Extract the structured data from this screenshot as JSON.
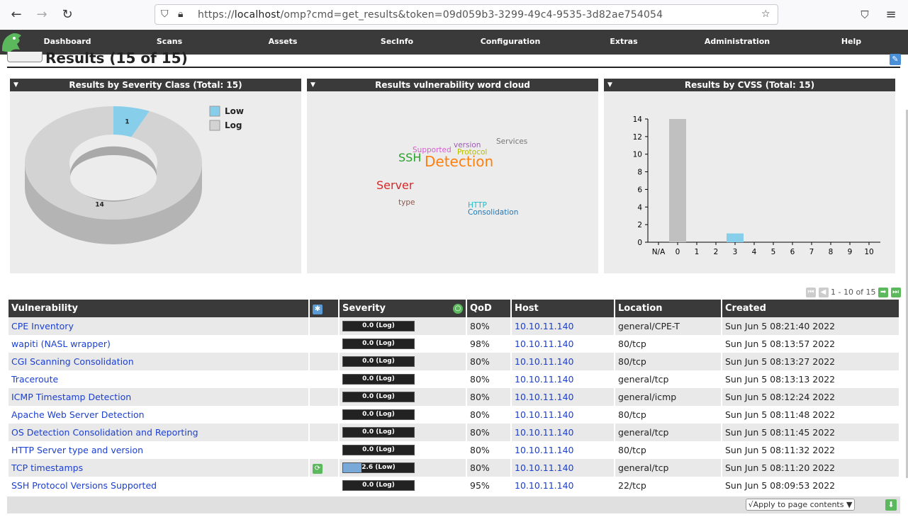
{
  "browser": {
    "url_prefix": "https://",
    "url_host": "localhost",
    "url_path": "/omp?cmd=get_results&token=09d059b3-3299-49c4-9535-3d82ae754054"
  },
  "menu": [
    "Dashboard",
    "Scans",
    "Assets",
    "SecInfo",
    "Configuration",
    "Extras",
    "Administration",
    "Help"
  ],
  "page": {
    "title": "Results (15 of 15)"
  },
  "panels": {
    "severity": {
      "title": "Results by Severity Class (Total: 15)"
    },
    "wordcloud": {
      "title": "Results vulnerability word cloud"
    },
    "cvss": {
      "title": "Results by CVSS (Total: 15)"
    }
  },
  "chart_data": [
    {
      "type": "pie",
      "title": "Results by Severity Class (Total: 15)",
      "categories": [
        "Low",
        "Log"
      ],
      "values": [
        1,
        14
      ],
      "colors": [
        "#87ceeb",
        "#d3d3d3"
      ],
      "legend": "top-right"
    },
    {
      "type": "bar",
      "title": "Results by CVSS (Total: 15)",
      "categories": [
        "N/A",
        "0",
        "1",
        "2",
        "3",
        "4",
        "5",
        "6",
        "7",
        "8",
        "9",
        "10"
      ],
      "values": [
        0,
        14,
        0,
        0,
        1,
        0,
        0,
        0,
        0,
        0,
        0,
        0
      ],
      "colors": [
        "#c0c0c0",
        "#c0c0c0",
        "#87ceeb",
        "#87ceeb",
        "#87ceeb",
        "#ffa500",
        "#ffa500",
        "#ffa500",
        "#ff0000",
        "#ff0000",
        "#ff0000",
        "#ff0000"
      ],
      "ylim": [
        0,
        14
      ],
      "yticks": [
        0,
        2,
        4,
        6,
        8,
        10,
        12,
        14
      ]
    }
  ],
  "wordcloud": [
    {
      "text": "Services",
      "color": "#777777"
    },
    {
      "text": "version",
      "color": "#9b59b6"
    },
    {
      "text": "Supported",
      "color": "#d45ecf"
    },
    {
      "text": "Protocol",
      "color": "#b5bd00"
    },
    {
      "text": "SSH",
      "color": "#2ca02c"
    },
    {
      "text": "Detection",
      "color": "#ff7f0e"
    },
    {
      "text": "Server",
      "color": "#d62728"
    },
    {
      "text": "type",
      "color": "#8c564b"
    },
    {
      "text": "HTTP",
      "color": "#17becf"
    },
    {
      "text": "Consolidation",
      "color": "#1f77b4"
    }
  ],
  "pager": {
    "text": "1 - 10 of 15"
  },
  "table": {
    "headers": [
      "Vulnerability",
      "",
      "Severity",
      "QoD",
      "Host",
      "Location",
      "Created"
    ],
    "rows": [
      {
        "vuln": "CPE Inventory",
        "sev": "0.0 (Log)",
        "sev_value": 0.0,
        "qod": "80%",
        "host": "10.10.11.140",
        "loc": "general/CPE-T",
        "created": "Sun Jun 5 08:21:40 2022",
        "icon": false
      },
      {
        "vuln": "wapiti (NASL wrapper)",
        "sev": "0.0 (Log)",
        "sev_value": 0.0,
        "qod": "98%",
        "host": "10.10.11.140",
        "loc": "80/tcp",
        "created": "Sun Jun 5 08:13:57 2022",
        "icon": false
      },
      {
        "vuln": "CGI Scanning Consolidation",
        "sev": "0.0 (Log)",
        "sev_value": 0.0,
        "qod": "80%",
        "host": "10.10.11.140",
        "loc": "80/tcp",
        "created": "Sun Jun 5 08:13:27 2022",
        "icon": false
      },
      {
        "vuln": "Traceroute",
        "sev": "0.0 (Log)",
        "sev_value": 0.0,
        "qod": "80%",
        "host": "10.10.11.140",
        "loc": "general/tcp",
        "created": "Sun Jun 5 08:13:13 2022",
        "icon": false
      },
      {
        "vuln": "ICMP Timestamp Detection",
        "sev": "0.0 (Log)",
        "sev_value": 0.0,
        "qod": "80%",
        "host": "10.10.11.140",
        "loc": "general/icmp",
        "created": "Sun Jun 5 08:12:24 2022",
        "icon": false
      },
      {
        "vuln": "Apache Web Server Detection",
        "sev": "0.0 (Log)",
        "sev_value": 0.0,
        "qod": "80%",
        "host": "10.10.11.140",
        "loc": "80/tcp",
        "created": "Sun Jun 5 08:11:48 2022",
        "icon": false
      },
      {
        "vuln": "OS Detection Consolidation and Reporting",
        "sev": "0.0 (Log)",
        "sev_value": 0.0,
        "qod": "80%",
        "host": "10.10.11.140",
        "loc": "general/tcp",
        "created": "Sun Jun 5 08:11:45 2022",
        "icon": false
      },
      {
        "vuln": "HTTP Server type and version",
        "sev": "0.0 (Log)",
        "sev_value": 0.0,
        "qod": "80%",
        "host": "10.10.11.140",
        "loc": "80/tcp",
        "created": "Sun Jun 5 08:11:32 2022",
        "icon": false
      },
      {
        "vuln": "TCP timestamps",
        "sev": "2.6 (Low)",
        "sev_value": 2.6,
        "qod": "80%",
        "host": "10.10.11.140",
        "loc": "general/tcp",
        "created": "Sun Jun 5 08:11:20 2022",
        "icon": true
      },
      {
        "vuln": "SSH Protocol Versions Supported",
        "sev": "0.0 (Log)",
        "sev_value": 0.0,
        "qod": "95%",
        "host": "10.10.11.140",
        "loc": "22/tcp",
        "created": "Sun Jun 5 08:09:53 2022",
        "icon": false
      }
    ]
  },
  "footer": {
    "apply_label": "√Apply to page contents ▼"
  }
}
